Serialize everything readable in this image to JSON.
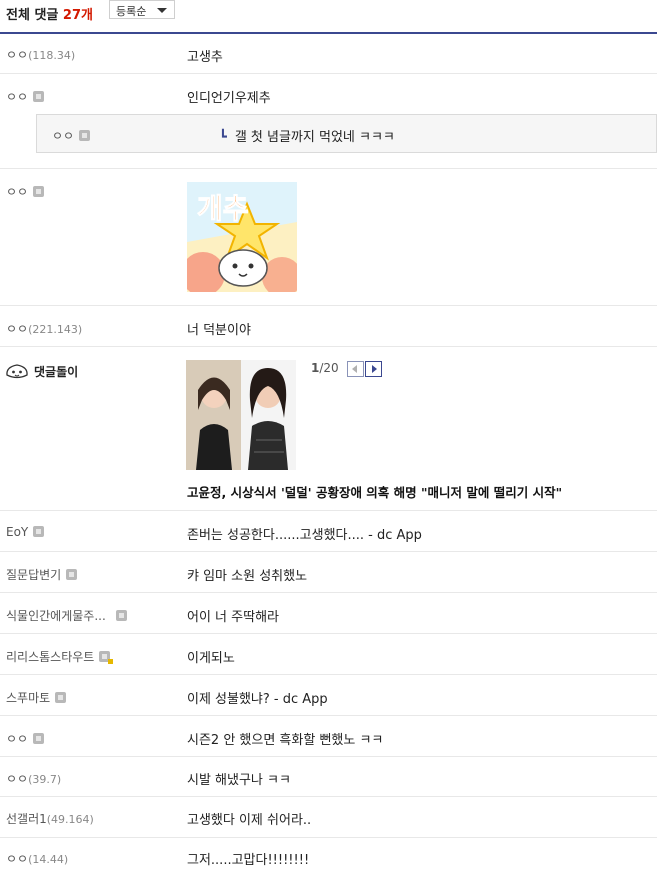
{
  "header": {
    "title_prefix": "전체 댓글",
    "count": "27개",
    "sort_label": "등록순"
  },
  "comments": [
    {
      "nick": "ㅇㅇ",
      "ip": "(118.34)",
      "text": "고생추"
    },
    {
      "nick": "ㅇㅇ",
      "text": "인디언기우제추"
    },
    {
      "nick": "ㅇㅇ",
      "text": "갤 첫 념글까지 먹었네 ㅋㅋㅋ"
    },
    {
      "nick": "ㅇㅇ",
      "sticker_text": "개추"
    },
    {
      "nick": "ㅇㅇ",
      "ip": "(221.143)",
      "text": "너 덕분이야"
    },
    {
      "nick": "댓글돌이",
      "page_current": "1",
      "page_total": "/20",
      "news_title": "고윤정, 시상식서 '덜덜' 공황장애 의혹 해명 \"매니저 말에 떨리기 시작\""
    },
    {
      "nick": "EoY",
      "text": "존버는 성공한다......고생했다.... - dc App"
    },
    {
      "nick": "질문답변기",
      "text": "캬 임마 소원 성취했노"
    },
    {
      "nick": "식물인간에게물주...",
      "text": "어이 너 주딱해라"
    },
    {
      "nick": "리리스톰스타우트",
      "text": "이게되노"
    },
    {
      "nick": "스푸마토",
      "text": "이제 성불했냐? - dc App"
    },
    {
      "nick": "ㅇㅇ",
      "text": "시즌2 안 했으면 흑화할 뻔했노 ㅋㅋ"
    },
    {
      "nick": "ㅇㅇ",
      "ip": "(39.7)",
      "text": "시발 해냈구나 ㅋㅋ"
    },
    {
      "nick": "선갤러1",
      "ip": "(49.164)",
      "text": "고생했다 이제 쉬어라.."
    },
    {
      "nick": "ㅇㅇ",
      "ip": "(14.44)",
      "text": "그저.....고맙다!!!!!!!!"
    }
  ]
}
